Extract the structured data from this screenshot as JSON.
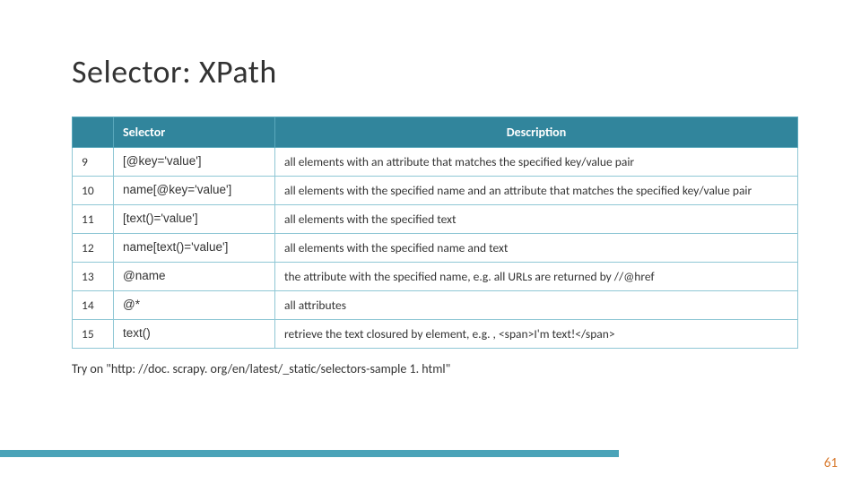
{
  "title": "Selector: XPath",
  "headers": {
    "num": "",
    "selector": "Selector",
    "description": "Description"
  },
  "rows": [
    {
      "num": "9",
      "selector": "[@key='value']",
      "description": "all elements with an attribute that matches the specified key/value pair"
    },
    {
      "num": "10",
      "selector": "name[@key='value']",
      "description": "all elements with the specified name and an attribute that matches the specified key/value pair"
    },
    {
      "num": "11",
      "selector": "[text()='value']",
      "description": "all elements with the specified text"
    },
    {
      "num": "12",
      "selector": "name[text()='value']",
      "description": "all elements with the specified name and text"
    },
    {
      "num": "13",
      "selector": "@name",
      "description": "the attribute with the specified name, e.g. all URLs are returned by //@href"
    },
    {
      "num": "14",
      "selector": "@*",
      "description": "all attributes"
    },
    {
      "num": "15",
      "selector": "text()",
      "description": "retrieve the text closured by element, e.g. , <span>I'm text!</span>"
    }
  ],
  "note": "Try on \"http: //doc. scrapy. org/en/latest/_static/selectors-sample 1. html\"",
  "page_number": "61",
  "colors": {
    "header_bg": "#31859c",
    "border": "#8fc7d5",
    "footer_bar": "#4aa3b8",
    "page_num": "#d97b30"
  }
}
